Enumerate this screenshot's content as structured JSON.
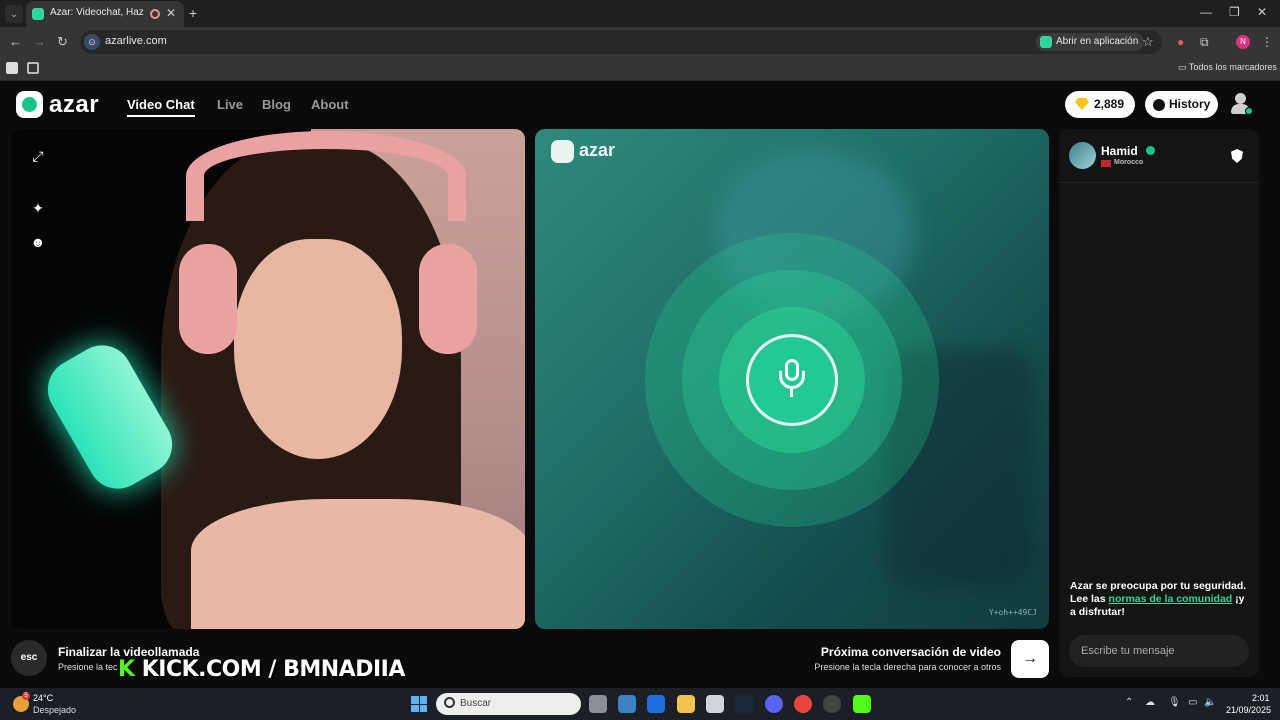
{
  "browser": {
    "tab_title": "Azar: Videochat, Haz nuevo",
    "url": "azarlive.com",
    "open_in_app": "Abrir en aplicación",
    "all_bookmarks": "Todos los marcadores",
    "profile_initial": "N"
  },
  "header": {
    "logo_text": "azar",
    "nav": [
      {
        "label": "Video Chat",
        "active": true
      },
      {
        "label": "Live"
      },
      {
        "label": "Blog"
      },
      {
        "label": "About"
      }
    ],
    "gems": "2,889",
    "history_label": "History"
  },
  "video_right": {
    "logo_text": "azar",
    "watermark_id": "Y+oh++49CJ"
  },
  "chat": {
    "partner_name": "Hamid",
    "partner_country": "Morocco",
    "safety_text_1": "Azar se preocupa por tu seguridad. Lee las ",
    "safety_link": "normas de la comunidad",
    "safety_text_2": " ¡y a disfrutar!",
    "input_placeholder": "Escribe tu mensaje"
  },
  "controls": {
    "esc_label": "esc",
    "end_title": "Finalizar la videollamada",
    "end_sub": "Presione la tec",
    "kick_overlay_k": "K",
    "kick_overlay_text": " KICK.COM / BMNADIIA",
    "next_title": "Próxima conversación de video",
    "next_sub": "Presione la tecla derecha para conocer a otros",
    "next_arrow": "→"
  },
  "taskbar": {
    "temperature": "24°C",
    "condition": "Despejado",
    "weather_badge": "5",
    "search_placeholder": "Buscar",
    "time": "2:01",
    "date": "21/09/2025"
  },
  "colors": {
    "brand_green": "#19c48a",
    "link_green": "#2fd6a0",
    "gem_yellow": "#f5c518"
  }
}
